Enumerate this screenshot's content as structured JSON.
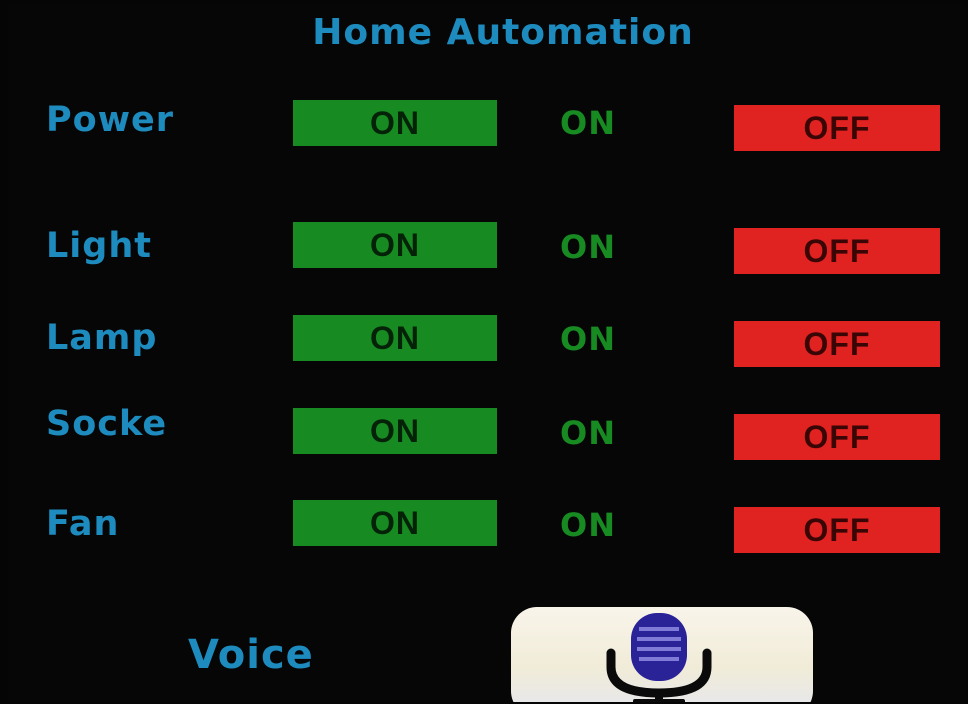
{
  "app": {
    "title": "Home Automation"
  },
  "colors": {
    "label": "#1e8bbf",
    "on_button": "#178a22",
    "status_on": "#178a22",
    "off_button": "#e02220",
    "background": "#050505"
  },
  "devices": [
    {
      "name": "Power",
      "on_label": "ON",
      "status": "ON",
      "off_label": "OFF"
    },
    {
      "name": "Light",
      "on_label": "ON",
      "status": "ON",
      "off_label": "OFF"
    },
    {
      "name": "Lamp",
      "on_label": "ON",
      "status": "ON",
      "off_label": "OFF"
    },
    {
      "name": "Socke",
      "on_label": "ON",
      "status": "ON",
      "off_label": "OFF"
    },
    {
      "name": "Fan",
      "on_label": "ON",
      "status": "ON",
      "off_label": "OFF"
    }
  ],
  "voice": {
    "label": "Voice",
    "icon": "microphone-icon"
  }
}
